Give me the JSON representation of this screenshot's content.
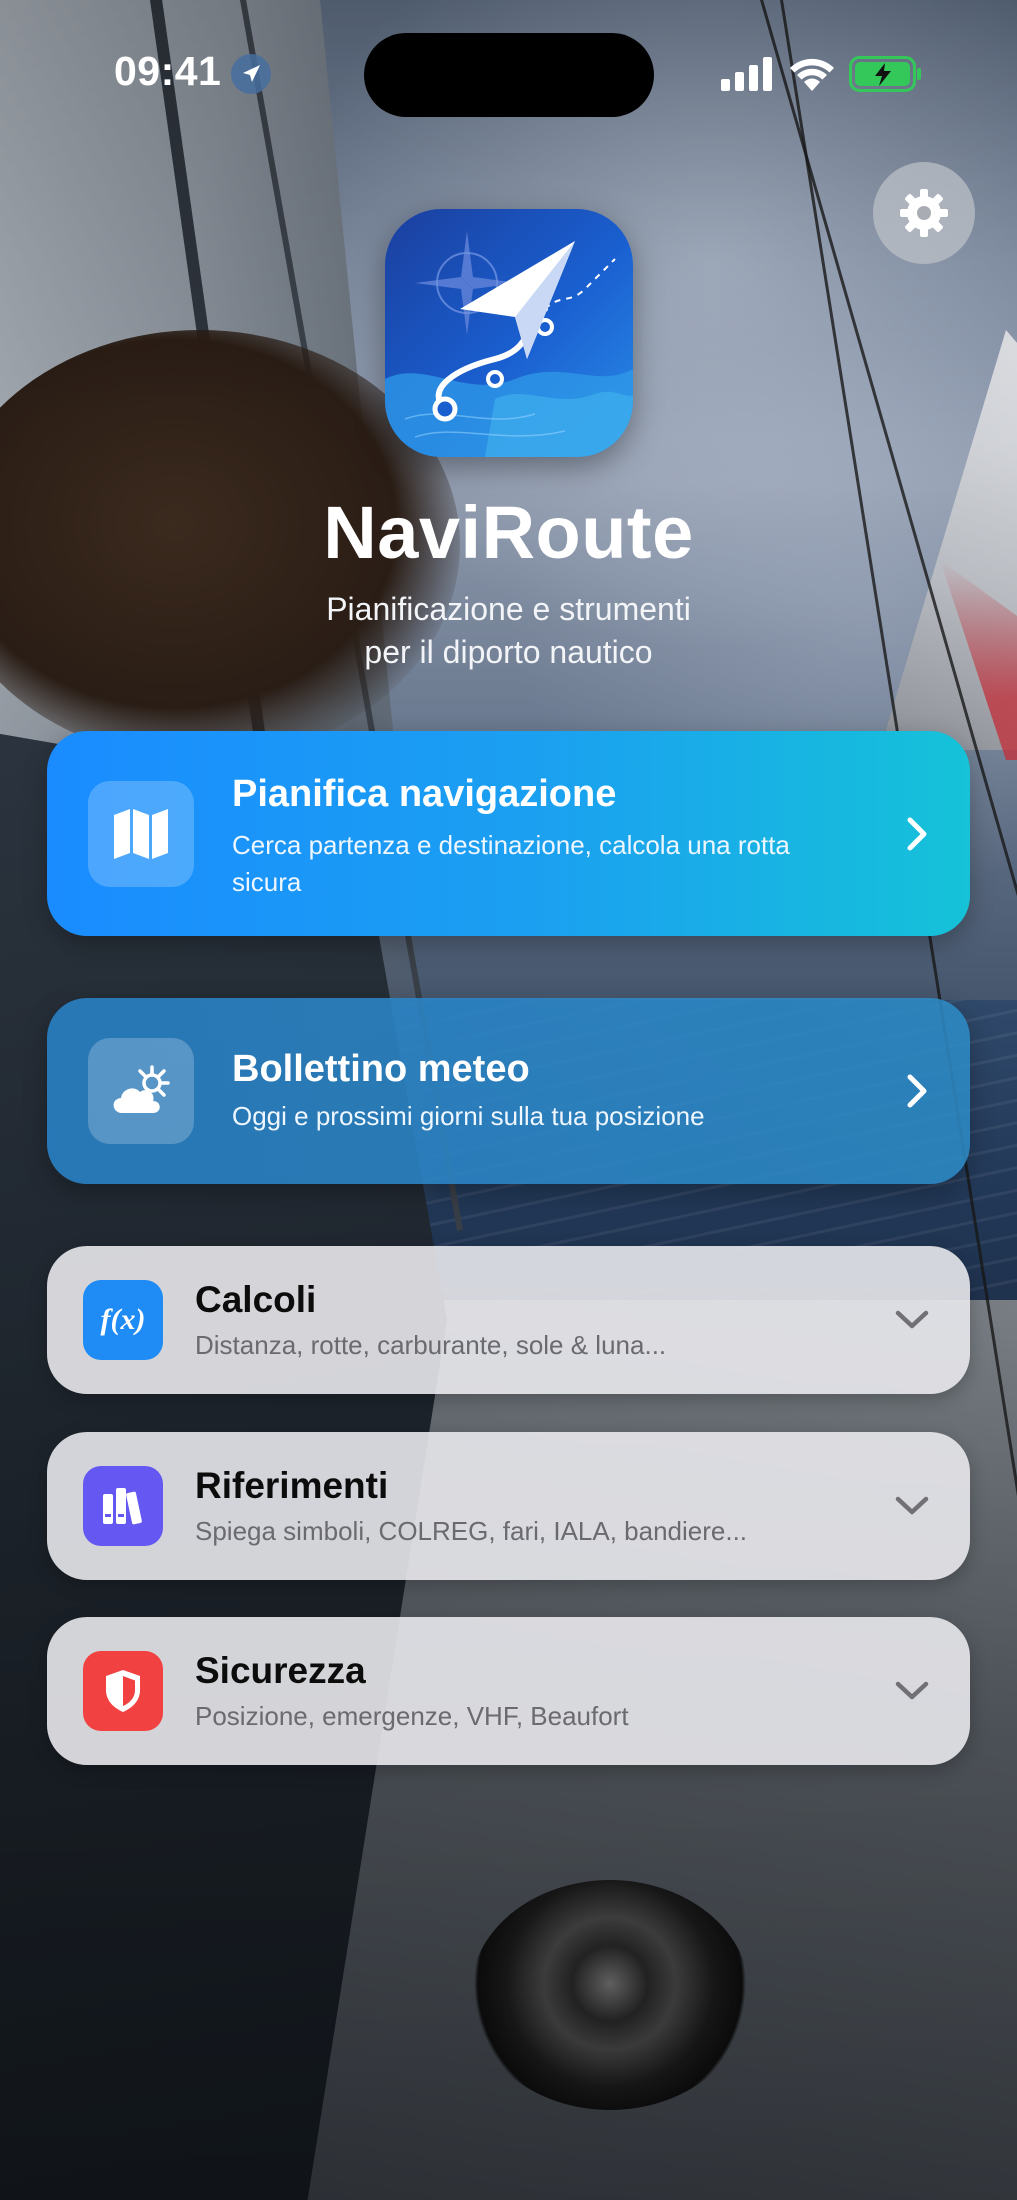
{
  "status_bar": {
    "time": "09:41",
    "icons": [
      "location-arrow-icon",
      "cellular-signal-icon",
      "wifi-icon",
      "battery-charging-icon"
    ]
  },
  "settings": {
    "icon": "gear-icon"
  },
  "header": {
    "app_name": "NaviRoute",
    "subtitle_line1": "Pianificazione e strumenti",
    "subtitle_line2": "per il diporto nautico",
    "app_icon": "compass-route-icon"
  },
  "primary_cards": [
    {
      "title": "Pianifica navigazione",
      "description": "Cerca partenza e destinazione, calcola una rotta sicura",
      "icon": "map-icon",
      "accent": "#1a8cff"
    },
    {
      "title": "Bollettino meteo",
      "description": "Oggi e prossimi giorni sulla tua posizione",
      "icon": "partly-cloudy-icon",
      "accent": "#2882c8"
    }
  ],
  "sections": [
    {
      "title": "Calcoli",
      "description": "Distanza, rotte, carburante, sole & luna...",
      "icon": "function-icon",
      "icon_glyph": "f(x)",
      "color": "#1f8bf5"
    },
    {
      "title": "Riferimenti",
      "description": "Spiega simboli, COLREG, fari, IALA, bandiere...",
      "icon": "books-icon",
      "color": "#6457f2"
    },
    {
      "title": "Sicurezza",
      "description": "Posizione, emergenze, VHF, Beaufort",
      "icon": "shield-icon",
      "color": "#f24141"
    }
  ]
}
